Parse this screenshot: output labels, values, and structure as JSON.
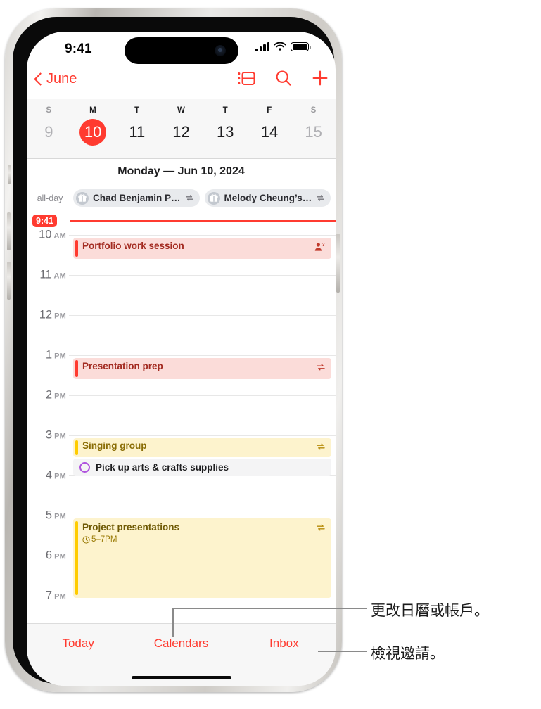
{
  "status_bar": {
    "time": "9:41",
    "icons": [
      "cellular-signal-icon",
      "wifi-icon",
      "battery-icon"
    ]
  },
  "nav": {
    "back_label": "June",
    "back_icon": "chevron-left-icon",
    "actions": [
      {
        "name": "day-list-view-icon",
        "label": "Day List View"
      },
      {
        "name": "search-icon",
        "label": "Search"
      },
      {
        "name": "add-event-icon",
        "label": "Add Event"
      }
    ]
  },
  "week_strip": {
    "days": [
      {
        "dow": "S",
        "num": "9",
        "state": "dim"
      },
      {
        "dow": "M",
        "num": "10",
        "state": "today"
      },
      {
        "dow": "T",
        "num": "11",
        "state": "normal"
      },
      {
        "dow": "W",
        "num": "12",
        "state": "normal"
      },
      {
        "dow": "T",
        "num": "13",
        "state": "normal"
      },
      {
        "dow": "F",
        "num": "14",
        "state": "normal"
      },
      {
        "dow": "S",
        "num": "15",
        "state": "dim"
      }
    ]
  },
  "day_header": {
    "title": "Monday — Jun 10, 2024"
  },
  "all_day": {
    "label": "all-day",
    "events": [
      {
        "title": "Chad Benjamin P…",
        "icon": "gift-icon",
        "badge": "repeat-icon"
      },
      {
        "title": "Melody Cheung’s…",
        "icon": "gift-icon",
        "badge": "repeat-icon"
      }
    ]
  },
  "timeline": {
    "now_time": "9:41",
    "hours": [
      {
        "hour": "10",
        "period": "AM"
      },
      {
        "hour": "11",
        "period": "AM"
      },
      {
        "hour": "12",
        "period": "PM"
      },
      {
        "hour": "1",
        "period": "PM"
      },
      {
        "hour": "2",
        "period": "PM"
      },
      {
        "hour": "3",
        "period": "PM"
      },
      {
        "hour": "4",
        "period": "PM"
      },
      {
        "hour": "5",
        "period": "PM"
      },
      {
        "hour": "6",
        "period": "PM"
      },
      {
        "hour": "7",
        "period": "PM"
      }
    ],
    "events": [
      {
        "title": "Portfolio work session",
        "subtitle": "",
        "badge": "invitee-pending-icon",
        "color_bar": "#ff3b30",
        "color_bg": "#fbdcd9",
        "color_text": "#a32b21"
      },
      {
        "title": "Presentation prep",
        "subtitle": "",
        "badge": "repeat-icon",
        "color_bar": "#ff3b30",
        "color_bg": "#fbdcd9",
        "color_text": "#a32b21"
      },
      {
        "title": "Singing group",
        "subtitle": "",
        "badge": "repeat-icon",
        "color_bar": "#ffcc00",
        "color_bg": "#fdf3cd",
        "color_text": "#8a6d06"
      },
      {
        "title": "Project presentations",
        "subtitle": "5–7PM",
        "subtitle_icon": "alarm-clock-icon",
        "badge": "repeat-icon",
        "color_bar": "#ffcc00",
        "color_bg": "#fdf3cd",
        "color_text": "#8a6d06"
      }
    ],
    "reminders": [
      {
        "title": "Pick up arts & crafts supplies",
        "circle_color": "#af52de"
      }
    ]
  },
  "tab_bar": {
    "items": [
      {
        "name": "tab-today",
        "label": "Today"
      },
      {
        "name": "tab-calendars",
        "label": "Calendars"
      },
      {
        "name": "tab-inbox",
        "label": "Inbox"
      }
    ]
  },
  "callouts": [
    {
      "text": "更改日曆或帳戶。",
      "target": "tab-calendars"
    },
    {
      "text": "檢視邀請。",
      "target": "tab-inbox"
    }
  ],
  "colors": {
    "accent_red": "#ff3b30",
    "yellow": "#ffcc00",
    "purple": "#af52de",
    "screen_bg": "#ffffff",
    "chrome_bg": "#f7f7f7"
  }
}
